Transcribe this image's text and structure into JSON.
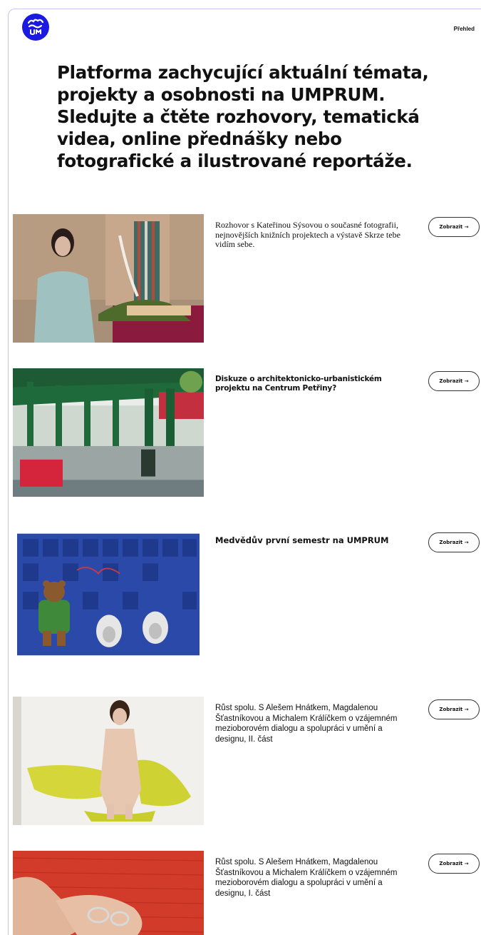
{
  "header": {
    "nav_label": "Přehled"
  },
  "intro": {
    "text": "Platforma zachycující aktuální témata, projekty a osobnosti na UMPRUM. Sledujte a čtěte rozhovory, tematická videa, online přednášky nebo fotografické a ilustrované reportáže."
  },
  "colors": {
    "brand": "#1a1ae0",
    "border": "#c9c6ee"
  },
  "items": [
    {
      "title": "Rozhovor s Kateřinou Sýsovou o současné fotografii, nejnovějších knižních projektech a výstavě Skrze tebe vidím sebe.",
      "button": "Zobrazit →"
    },
    {
      "title": "Diskuze o architektonicko-urbanistickém projektu na Centrum Petřiny?",
      "button": "Zobrazit →"
    },
    {
      "title": "Medvědův první semestr na UMPRUM",
      "button": "Zobrazit →"
    },
    {
      "title": "Růst spolu. S Alešem Hnátkem, Magdalenou Šťastníkovou a Michalem Králíčkem o vzájemném mezioborovém dialogu a spolupráci v umění a designu, II. část",
      "button": "Zobrazit →"
    },
    {
      "title": "Růst spolu. S Alešem Hnátkem, Magdalenou Šťastníkovou a Michalem Králíčkem o vzájemném mezioborovém dialogu a spolupráci v umění a designu, I. část",
      "button": "Zobrazit →"
    }
  ]
}
